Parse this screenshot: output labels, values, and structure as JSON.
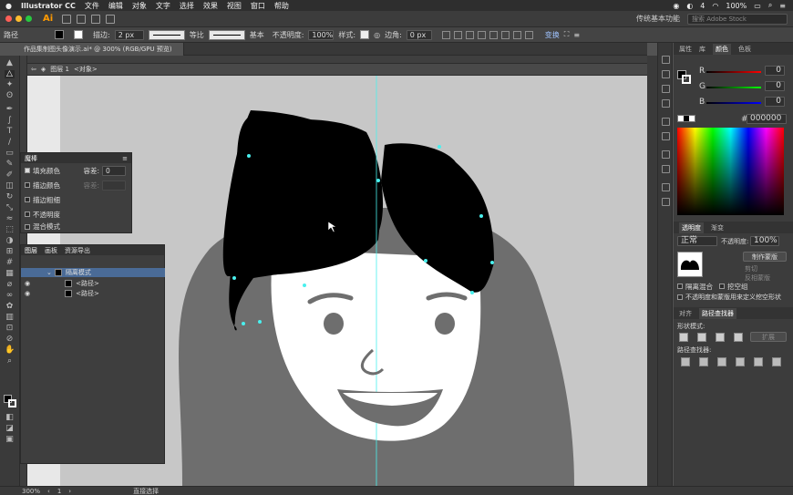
{
  "mac_menubar": {
    "app_name": "Illustrator CC",
    "menus": [
      "文件",
      "编辑",
      "对象",
      "文字",
      "选择",
      "效果",
      "视图",
      "窗口",
      "帮助"
    ],
    "battery": "100%",
    "date_short": "4"
  },
  "app_bar": {
    "logo": "Ai",
    "workspace": "传统基本功能",
    "stock_search_placeholder": "搜索 Adobe Stock"
  },
  "control_bar": {
    "selection_label": "路径",
    "stroke_label": "描边:",
    "stroke_weight": "2 px",
    "stroke_profile": "等比",
    "brush": "基本",
    "opacity_label": "不透明度:",
    "opacity_value": "100%",
    "style_label": "样式:",
    "corner_label": "边角:",
    "corner_value": "0 px",
    "transform_label": "变换"
  },
  "document": {
    "tab_title": "作品集制图头像演示.ai* @ 300% (RGB/GPU 预览)",
    "breadcrumb_layer": "图层 1",
    "breadcrumb_object": "<对象>"
  },
  "magic_wand_panel": {
    "title": "魔棒",
    "fill_color": "填充颜色",
    "tolerance_label": "容差:",
    "tolerance_value": "0",
    "stroke_color": "描边颜色",
    "stroke_weight": "描边粗细",
    "opacity": "不透明度",
    "blend_mode": "混合模式",
    "dim_tolerance_label": "容差:"
  },
  "layers_panel": {
    "tabs": [
      "图层",
      "画板",
      "资源导出"
    ],
    "group_name": "隔离模式",
    "path1": "<路径>",
    "path2": "<路径>"
  },
  "color_panel": {
    "tabs": [
      "属性",
      "库",
      "颜色",
      "色板"
    ],
    "r_label": "R",
    "r_value": "0",
    "g_label": "G",
    "g_value": "0",
    "b_label": "B",
    "b_value": "0",
    "hex_label": "#",
    "hex": "000000"
  },
  "transparency_panel": {
    "tabs": [
      "透明度",
      "渐变"
    ],
    "blend": "正常",
    "opacity_label": "不透明度:",
    "opacity_value": "100%",
    "make_mask": "制作蒙版",
    "clip": "剪切",
    "invert_mask": "反相蒙版",
    "isolate_blending": "隔离混合",
    "knockout_group": "挖空组",
    "opacity_mask_defines": "不透明度和蒙版用来定义挖空形状"
  },
  "pathfinder_panel": {
    "tabs": [
      "对齐",
      "路径查找器"
    ],
    "shape_modes": "形状模式:",
    "expand": "扩展",
    "pathfinders": "路径查找器:"
  },
  "status_bar": {
    "zoom": "300%",
    "page": "1",
    "tool": "直接选择"
  },
  "colors": {
    "accent_selection": "#4af0ee",
    "hair": "#000000",
    "face": "#ffffff",
    "body_gray": "#6e6e6e",
    "feature_gray": "#6e6e6e"
  }
}
